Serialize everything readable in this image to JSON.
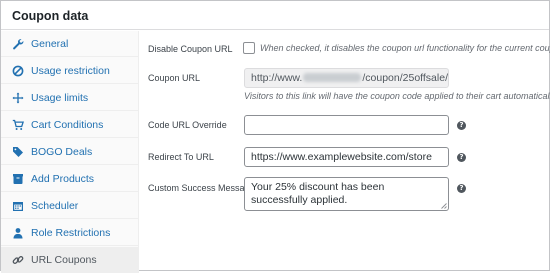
{
  "panel": {
    "title": "Coupon data"
  },
  "tabs": [
    {
      "label": "General",
      "icon": "wrench-icon"
    },
    {
      "label": "Usage restriction",
      "icon": "ban-icon"
    },
    {
      "label": "Usage limits",
      "icon": "move-cross-icon"
    },
    {
      "label": "Cart Conditions",
      "icon": "cart-icon"
    },
    {
      "label": "BOGO Deals",
      "icon": "tag-icon"
    },
    {
      "label": "Add Products",
      "icon": "box-icon"
    },
    {
      "label": "Scheduler",
      "icon": "calendar-icon"
    },
    {
      "label": "Role Restrictions",
      "icon": "person-icon"
    },
    {
      "label": "URL Coupons",
      "icon": "link-icon",
      "active": true
    }
  ],
  "fields": {
    "disable_url": {
      "label": "Disable Coupon URL",
      "checked": false,
      "description": "When checked, it disables the coupon url functionality for the current coupon."
    },
    "coupon_url": {
      "label": "Coupon URL",
      "value_prefix": "http://www.",
      "value_suffix": "/coupon/25offsale/",
      "description": "Visitors to this link will have the coupon code applied to their cart automatically."
    },
    "code_override": {
      "label": "Code URL Override",
      "value": ""
    },
    "redirect": {
      "label": "Redirect To URL",
      "value": "https://www.examplewebsite.com/store"
    },
    "success_message": {
      "label": "Custom Success Message",
      "value": "Your 25% discount has been successfully applied."
    }
  },
  "help_icon": "?",
  "colors": {
    "link": "#2271b1",
    "active_tab_bg": "#eeeeee",
    "sidebar_bg": "#fafafa",
    "border": "#8c8f94"
  }
}
